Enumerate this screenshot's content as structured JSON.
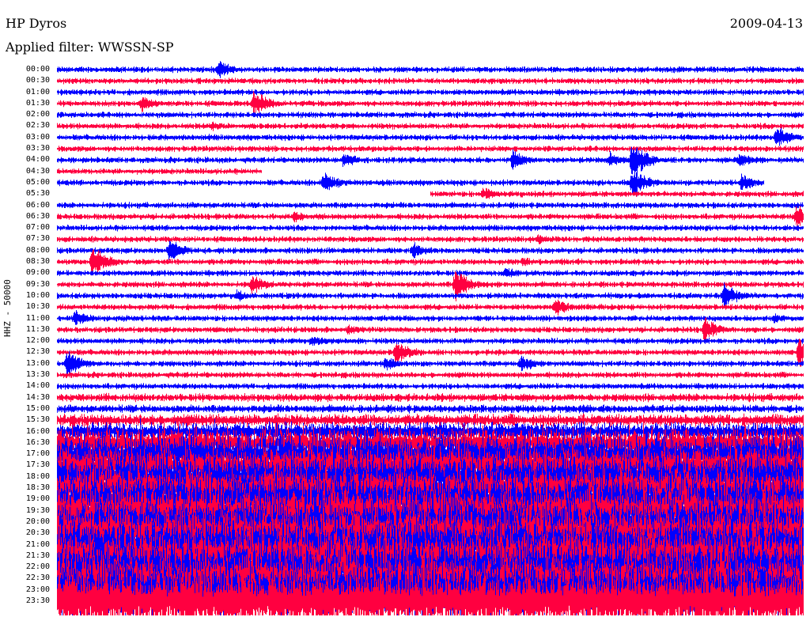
{
  "header": {
    "station": "HP Dyros",
    "date": "2009-04-13",
    "filter": "Applied filter: WWSSN-SP"
  },
  "chart_data": {
    "type": "line",
    "title": "HP Dyros 2009-04-13",
    "ylabel": "HHZ - 50000",
    "row_minutes": 30,
    "colors": [
      "#0000ff",
      "#ff0040"
    ],
    "rows": [
      "00:00",
      "00:30",
      "01:00",
      "01:30",
      "02:00",
      "02:30",
      "03:00",
      "03:30",
      "04:00",
      "04:30",
      "05:00",
      "05:30",
      "06:00",
      "06:30",
      "07:00",
      "07:30",
      "08:00",
      "08:30",
      "09:00",
      "09:30",
      "10:00",
      "10:30",
      "11:00",
      "11:30",
      "12:00",
      "12:30",
      "13:00",
      "13:30",
      "14:00",
      "14:30",
      "15:00",
      "15:30",
      "16:00",
      "16:30",
      "17:00",
      "17:30",
      "18:00",
      "18:30",
      "19:00",
      "19:30",
      "20:00",
      "20:30",
      "21:00",
      "21:30",
      "22:00",
      "22:30",
      "23:00",
      "23:30"
    ],
    "noise_level": [
      3,
      3,
      3,
      3,
      3,
      3,
      3,
      3,
      3,
      3,
      3,
      3,
      3,
      3,
      3,
      3,
      3,
      3,
      3,
      3,
      3,
      3,
      3,
      3,
      3,
      3,
      3,
      3,
      3,
      4,
      4,
      6,
      9,
      14,
      18,
      18,
      20,
      20,
      22,
      22,
      22,
      24,
      24,
      24,
      24,
      24,
      26,
      28
    ],
    "gaps": [
      {
        "row": 9,
        "from_min": 8.2,
        "to_min": 30
      },
      {
        "row": 10,
        "from_min": 28.4,
        "to_min": 30
      },
      {
        "row": 11,
        "from_min": 0,
        "to_min": 15.0
      }
    ],
    "events": [
      {
        "row": 0,
        "min": 6.5,
        "amp": 14
      },
      {
        "row": 3,
        "min": 3.4,
        "amp": 12
      },
      {
        "row": 3,
        "min": 7.9,
        "amp": 20
      },
      {
        "row": 5,
        "min": 6.2,
        "amp": 8
      },
      {
        "row": 6,
        "min": 28.9,
        "amp": 18
      },
      {
        "row": 8,
        "min": 11.5,
        "amp": 12
      },
      {
        "row": 8,
        "min": 18.3,
        "amp": 15
      },
      {
        "row": 8,
        "min": 22.2,
        "amp": 12
      },
      {
        "row": 8,
        "min": 23.1,
        "amp": 30
      },
      {
        "row": 8,
        "min": 27.4,
        "amp": 12
      },
      {
        "row": 10,
        "min": 10.7,
        "amp": 18
      },
      {
        "row": 10,
        "min": 23.1,
        "amp": 25
      },
      {
        "row": 10,
        "min": 27.5,
        "amp": 14
      },
      {
        "row": 11,
        "min": 17.1,
        "amp": 10
      },
      {
        "row": 13,
        "min": 9.5,
        "amp": 10
      },
      {
        "row": 13,
        "min": 29.7,
        "amp": 20
      },
      {
        "row": 15,
        "min": 19.3,
        "amp": 8
      },
      {
        "row": 16,
        "min": 4.5,
        "amp": 18
      },
      {
        "row": 16,
        "min": 14.3,
        "amp": 12
      },
      {
        "row": 17,
        "min": 1.4,
        "amp": 25
      },
      {
        "row": 17,
        "min": 18.7,
        "amp": 8
      },
      {
        "row": 18,
        "min": 18.0,
        "amp": 10
      },
      {
        "row": 19,
        "min": 7.8,
        "amp": 15
      },
      {
        "row": 19,
        "min": 16.0,
        "amp": 25
      },
      {
        "row": 20,
        "min": 7.2,
        "amp": 10
      },
      {
        "row": 20,
        "min": 26.8,
        "amp": 20
      },
      {
        "row": 21,
        "min": 20.0,
        "amp": 14
      },
      {
        "row": 22,
        "min": 0.7,
        "amp": 14
      },
      {
        "row": 22,
        "min": 28.8,
        "amp": 8
      },
      {
        "row": 23,
        "min": 11.7,
        "amp": 8
      },
      {
        "row": 23,
        "min": 26.0,
        "amp": 18
      },
      {
        "row": 24,
        "min": 10.2,
        "amp": 10
      },
      {
        "row": 25,
        "min": 13.6,
        "amp": 20
      },
      {
        "row": 25,
        "min": 29.8,
        "amp": 25
      },
      {
        "row": 26,
        "min": 0.4,
        "amp": 22
      },
      {
        "row": 26,
        "min": 13.2,
        "amp": 12
      },
      {
        "row": 26,
        "min": 18.6,
        "amp": 14
      },
      {
        "row": 29,
        "min": 18.7,
        "amp": 6
      },
      {
        "row": 30,
        "min": 21.0,
        "amp": 8
      }
    ]
  }
}
